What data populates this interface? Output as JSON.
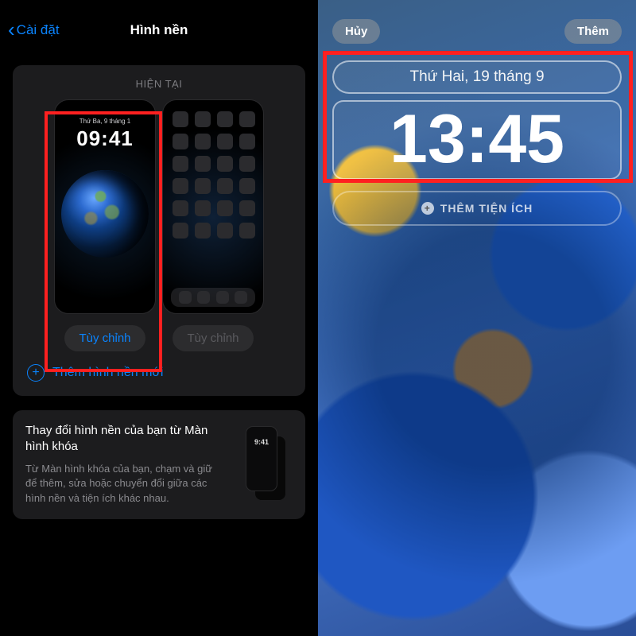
{
  "left": {
    "back_label": "Cài đặt",
    "title": "Hình nền",
    "current_label": "HIỆN TẠI",
    "lock_preview": {
      "date": "Thứ Ba, 9 tháng 1",
      "time": "09:41"
    },
    "customize_lock": "Tùy chỉnh",
    "customize_home": "Tùy chỉnh",
    "add_new": "Thêm hình nền mới",
    "info_title": "Thay đổi hình nền của bạn từ Màn hình khóa",
    "info_body": "Từ Màn hình khóa của bạn, chạm và giữ để thêm, sửa hoặc chuyển đổi giữa các hình nền và tiện ích khác nhau.",
    "mini_time": "9:41"
  },
  "right": {
    "cancel": "Hủy",
    "add": "Thêm",
    "date": "Thứ Hai, 19 tháng 9",
    "time": "13:45",
    "add_widgets": "THÊM TIỆN ÍCH"
  }
}
